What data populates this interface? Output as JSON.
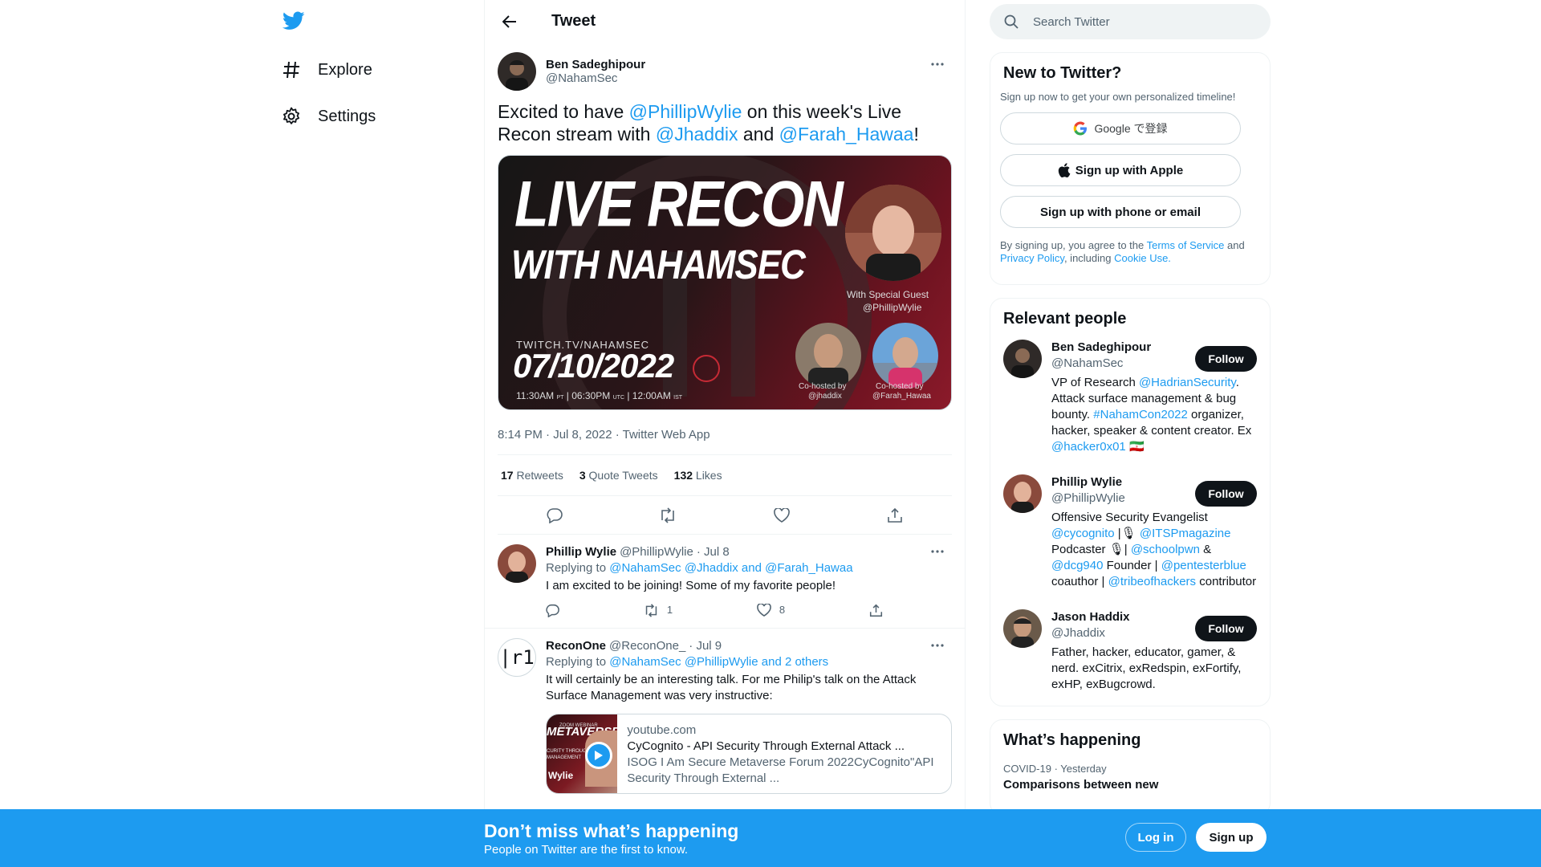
{
  "nav": {
    "logo_icon": "twitter-bird-icon",
    "items": [
      {
        "label": "Explore",
        "icon": "hashtag-icon"
      },
      {
        "label": "Settings",
        "icon": "gear-icon"
      }
    ]
  },
  "header": {
    "title": "Tweet"
  },
  "tweet": {
    "author_name": "Ben Sadeghipour",
    "author_handle": "@NahamSec",
    "text_parts": [
      "Excited to have ",
      "@PhillipWylie",
      " on this week's Live Recon stream with ",
      "@Jhaddix",
      " and ",
      "@Farah_Hawaa",
      "!"
    ],
    "media": {
      "line1": "LIVE RECON",
      "line2": "WITH NAHAMSEC",
      "guest_label": "With Special Guest",
      "guest_handle": "@PhillipWylie",
      "site": "TWITCH.TV/NAHAMSEC",
      "date": "07/10/2022",
      "time1": "11:30AM",
      "tz1": "PT",
      "time2": "06:30PM",
      "tz2": "UTC",
      "time3": "12:00AM",
      "tz3": "IST",
      "cohost_label": "Co-hosted by",
      "cohost1": "@jhaddix",
      "cohost2": "@Farah_Hawaa"
    },
    "meta": "8:14 PM · Jul 8, 2022 · Twitter Web App",
    "stats": {
      "retweets_count": "17",
      "retweets_label": "Retweets",
      "quotes_count": "3",
      "quotes_label": "Quote Tweets",
      "likes_count": "132",
      "likes_label": "Likes"
    }
  },
  "replies": [
    {
      "name": "Phillip Wylie",
      "handle": "@PhillipWylie",
      "date": "· Jul 8",
      "replying_prefix": "Replying to ",
      "replying_to": "@NahamSec @Jhaddix and @Farah_Hawaa",
      "text": "I am excited to be joining! Some of my favorite people!",
      "retweets": "1",
      "likes": "8"
    },
    {
      "name": "ReconOne",
      "handle": "@ReconOne_",
      "date": "· Jul 9",
      "replying_prefix": "Replying to ",
      "replying_to": "@NahamSec @PhillipWylie and 2 others",
      "text": "It will certainly be an interesting talk. For me Philip's talk on the Attack Surface Management was very instructive:",
      "avatar_text": "|r1",
      "card": {
        "domain": "youtube.com",
        "title": "CyCognito - API Security Through External Attack ...",
        "desc": "ISOG I Am Secure Metaverse Forum 2022CyCognito\"API Security Through External ...",
        "thumb_top": "ZOOM WEBINAR",
        "thumb_title": "METAVERSE",
        "thumb_sub": "CURITY THROUGH EX",
        "thumb_sub2": "MANAGEMENT",
        "thumb_name": "Wylie"
      }
    }
  ],
  "search": {
    "placeholder": "Search Twitter"
  },
  "new_to_twitter": {
    "title": "New to Twitter?",
    "subtitle": "Sign up now to get your own personalized timeline!",
    "google_label": "Google で登録",
    "apple_label": "Sign up with Apple",
    "phone_label": "Sign up with phone or email",
    "legal_1": "By signing up, you agree to the ",
    "terms": "Terms of Service",
    "legal_2": " and ",
    "privacy": "Privacy Policy",
    "legal_3": ", including ",
    "cookie": "Cookie Use."
  },
  "relevant": {
    "title": "Relevant people",
    "follow_label": "Follow",
    "people": [
      {
        "name": "Ben Sadeghipour",
        "handle": "@NahamSec"
      },
      {
        "name": "Phillip Wylie",
        "handle": "@PhillipWylie"
      },
      {
        "name": "Jason Haddix",
        "handle": "@Jhaddix",
        "bio": "Father, hacker, educator, gamer, & nerd. exCitrix, exRedspin, exFortify, exHP, exBugcrowd."
      }
    ],
    "bio1": [
      "VP of Research ",
      "@HadrianSecurity",
      ". Attack surface management & bug bounty. ",
      "#NahamCon2022",
      " organizer, hacker, speaker & content creator. Ex ",
      "@hacker0x01",
      " 🇮🇷"
    ],
    "bio2": [
      "Offensive Security Evangelist ",
      "@cycognito",
      " |🎙 ",
      "@ITSPmagazine",
      " Podcaster 🎙| ",
      "@schoolpwn",
      " & ",
      "@dcg940",
      " Founder | ",
      "@pentesterblue",
      " coauthor | ",
      "@tribeofhackers",
      " contributor"
    ]
  },
  "happening": {
    "title": "What’s happening",
    "topic": "COVID-19",
    "time": "· Yesterday",
    "headline": "Comparisons between new"
  },
  "bottom": {
    "title": "Don’t miss what’s happening",
    "subtitle": "People on Twitter are the first to know.",
    "login": "Log in",
    "signup": "Sign up"
  },
  "colors": {
    "accent": "#1d9bf0",
    "text": "#0f1419",
    "muted": "#536471"
  }
}
